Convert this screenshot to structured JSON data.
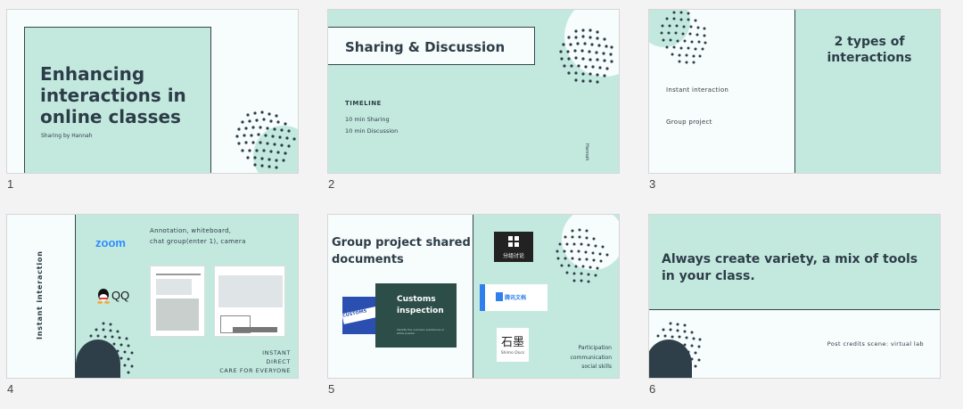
{
  "slide_numbers": [
    "1",
    "2",
    "3",
    "4",
    "5",
    "6"
  ],
  "slides": [
    {
      "title": "Enhancing interactions in online classes",
      "subtitle": "Sharing by Hannah"
    },
    {
      "title": "Sharing & Discussion",
      "timeline_label": "TIMELINE",
      "timeline": [
        "10 min  Sharing",
        "10 min  Discussion"
      ],
      "vertical_text": "Hannah"
    },
    {
      "title": "2 types of interactions",
      "items": [
        "Instant interaction",
        "Group project"
      ]
    },
    {
      "side_label": "Instant interaction",
      "zoom_logo": "zoom",
      "qq_logo": "QQ",
      "tools_text": "Annotation, whiteboard,\nchat group(enter 1), camera",
      "bottom_lines": [
        "INSTANT",
        "DIRECT",
        "CARE FOR EVERYONE"
      ]
    },
    {
      "title": "Group project shared documents",
      "card_title": "Customs inspection",
      "card_text": "Identify the unknown substances in white powder",
      "sign_text": "CUSTOMS",
      "app1": "分组讨论",
      "app2": "腾讯文档",
      "app3_title": "石墨",
      "app3_sub": "Shimo Docs",
      "bottom_lines": [
        "Participation",
        "communication",
        "social skills"
      ]
    },
    {
      "title": "Always create variety, a mix of tools in your class.",
      "footer": "Post credits scene: virtual lab"
    }
  ],
  "colors": {
    "mint": "#c3e9df",
    "navy": "#2d3d48",
    "white": "#f7fcfc"
  }
}
